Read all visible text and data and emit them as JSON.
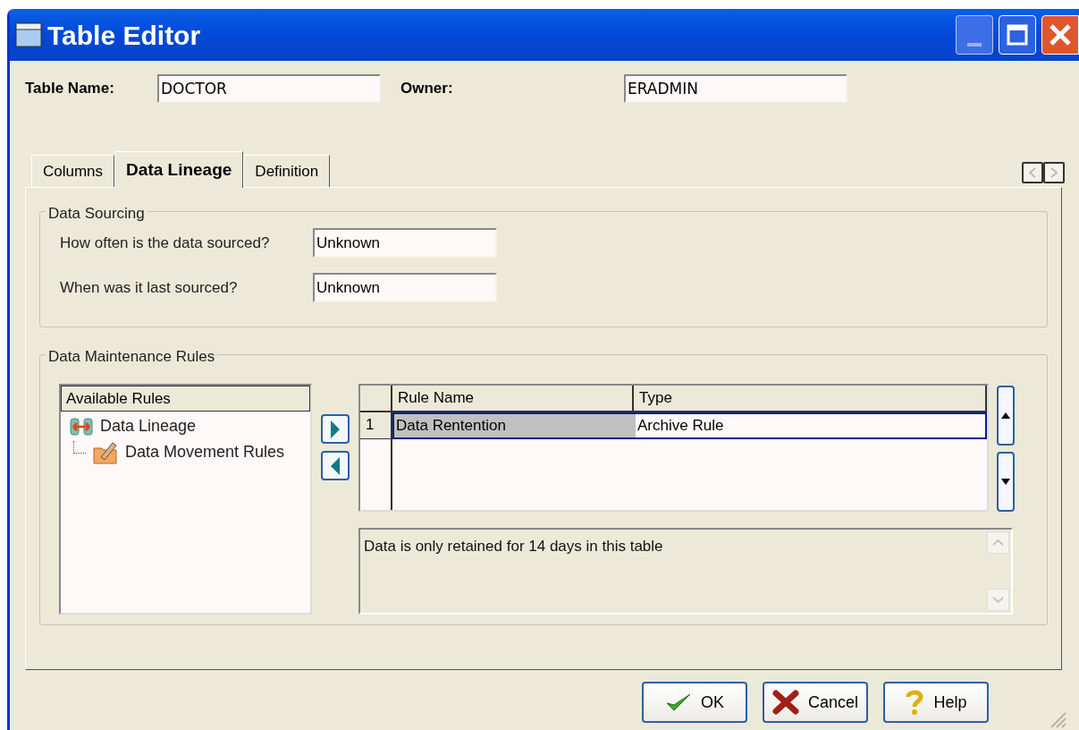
{
  "window": {
    "title": "Table Editor"
  },
  "header_fields": [
    {
      "label": "Table Name:",
      "value": "DOCTOR"
    },
    {
      "label": "Owner:",
      "value": "ERADMIN"
    }
  ],
  "tabs": [
    {
      "label": "Columns",
      "selected": false
    },
    {
      "label": "Data Lineage",
      "selected": true
    },
    {
      "label": "Definition",
      "selected": false
    }
  ],
  "data_sourcing": {
    "title": "Data Sourcing",
    "questions": [
      {
        "label": "How often is the data sourced?",
        "value": "Unknown"
      },
      {
        "label": "When was it last sourced?",
        "value": "Unknown"
      }
    ]
  },
  "maintenance": {
    "title": "Data Maintenance Rules",
    "available_rules": {
      "header": "Available Rules",
      "items": [
        {
          "label": "Data Lineage",
          "kind": "lineage",
          "children": [
            {
              "label": "Data Movement Rules",
              "kind": "folder"
            }
          ]
        }
      ]
    },
    "grid": {
      "columns": [
        "Rule Name",
        "Type"
      ],
      "rows": [
        {
          "number": "1",
          "cells": [
            "Data Rentention",
            "Archive Rule"
          ],
          "selected": true
        }
      ]
    },
    "description": "Data is only retained for 14 days in this table"
  },
  "buttons": [
    {
      "label": "OK",
      "kind": "ok"
    },
    {
      "label": "Cancel",
      "kind": "cancel"
    },
    {
      "label": "Help",
      "kind": "help"
    }
  ]
}
